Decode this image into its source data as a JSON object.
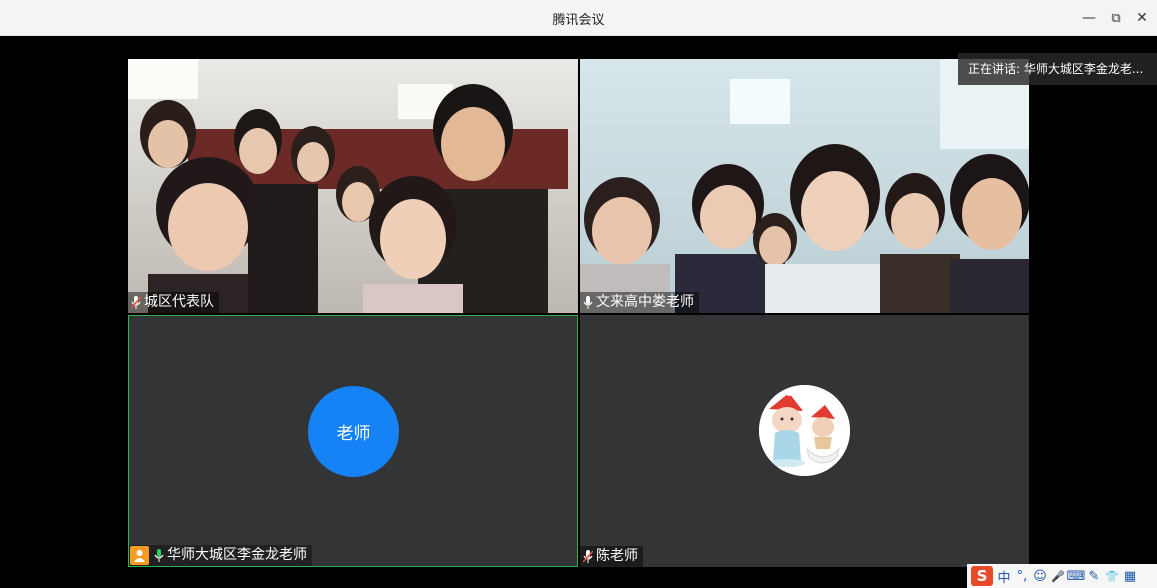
{
  "window": {
    "title": "腾讯会议",
    "minimize_label": "—",
    "restore_label": "⧉",
    "close_label": "✕"
  },
  "speaking": {
    "text": "正在讲话: 华师大城区李金龙老..."
  },
  "participants": [
    {
      "name": "城区代表队",
      "mic": "muted",
      "video": true
    },
    {
      "name": "文来高中娄老师",
      "mic": "on",
      "video": true
    },
    {
      "name": "华师大城区李金龙老师",
      "mic": "active",
      "video": false,
      "avatar_text": "老师",
      "host": true
    },
    {
      "name": "陈老师",
      "mic": "muted",
      "video": false,
      "avatar": "cartoon-figures"
    }
  ],
  "colors": {
    "accent_blue": "#1583f5",
    "active_green": "#2bb34a",
    "tile_bg": "#333436",
    "mic_muted": "#e74c3c"
  },
  "ime": {
    "logo": "S",
    "mode": "中",
    "punct": "°,",
    "emoji": "☺",
    "voice": "🎤",
    "keyboard": "⌨",
    "tools": "✎",
    "skin": "👕",
    "grid": "▦"
  }
}
